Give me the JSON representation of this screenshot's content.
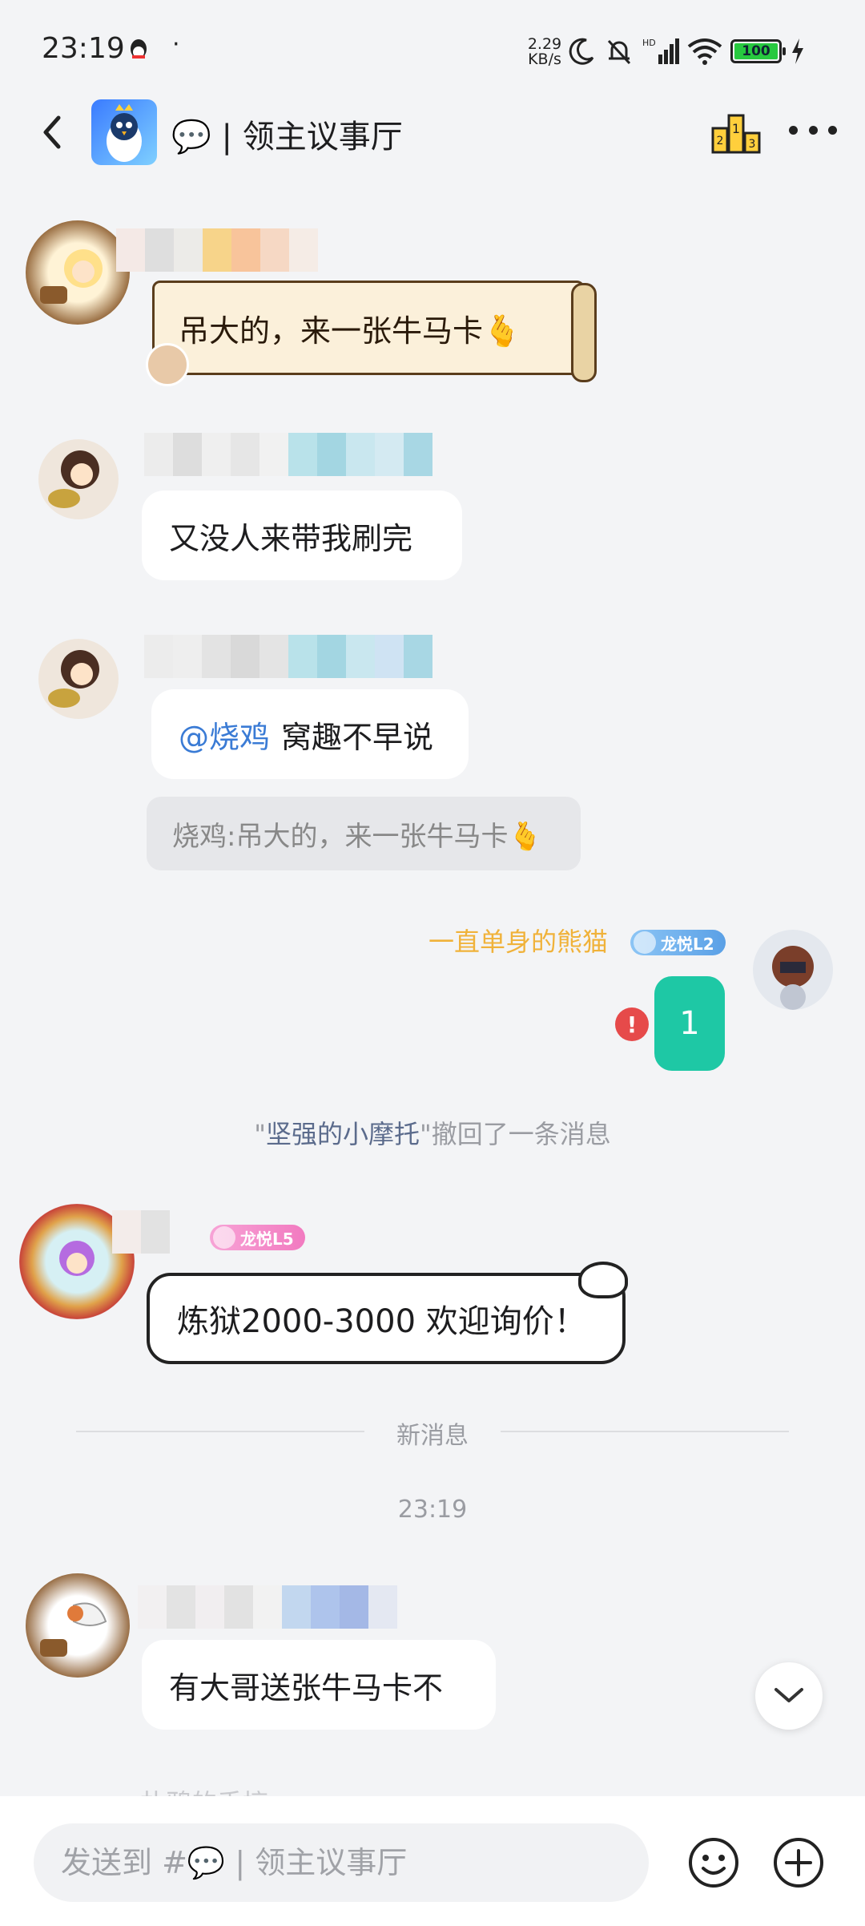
{
  "status_bar": {
    "time": "23:19",
    "dot": "·",
    "net_speed_value": "2.29",
    "net_speed_unit": "KB/s",
    "battery": "100",
    "icons": [
      "qq-icon",
      "moon-icon",
      "bell-off-icon",
      "signal-icon",
      "wifi-icon",
      "battery-icon",
      "charging-icon"
    ]
  },
  "header": {
    "title": "💬 | 领主议事厅",
    "icons": [
      "back-icon",
      "group-avatar",
      "ranking-icon",
      "more-icon"
    ]
  },
  "messages": [
    {
      "type": "incoming",
      "bubble_style": "scroll",
      "text": "吊大的，来一张牛马卡🫰"
    },
    {
      "type": "incoming",
      "text": "又没人来带我刷完"
    },
    {
      "type": "incoming",
      "mention": "@烧鸡",
      "text": "窝趣不早说",
      "quote": "烧鸡:吊大的，来一张牛马卡🫰"
    },
    {
      "type": "outgoing",
      "sender": "一直单身的熊猫",
      "badge": "龙悦L2",
      "text": "1",
      "error": "!"
    },
    {
      "type": "system",
      "quote_open": "\"",
      "who": "坚强的小摩托",
      "quote_close": "\"",
      "notice": "撤回了一条消息"
    },
    {
      "type": "incoming",
      "bubble_style": "cat",
      "badge": "龙悦L5",
      "text": "炼狱2000-3000 欢迎询价！"
    },
    {
      "type": "incoming",
      "text": "有大哥送张牛马卡不"
    }
  ],
  "divider": {
    "label": "新消息"
  },
  "timestamp": "23:19",
  "partial_sender": "扑鸦的手搞",
  "input": {
    "placeholder": "发送到 #💬 | 领主议事厅"
  },
  "colors": {
    "background": "#f3f4f6",
    "outgoing_bubble": "#1ec8a5",
    "mention": "#3a7bd5",
    "self_name": "#f0b23a",
    "error": "#e64a4a",
    "badge_l2": "#5aa0e6",
    "badge_l5": "#f27ac0"
  }
}
